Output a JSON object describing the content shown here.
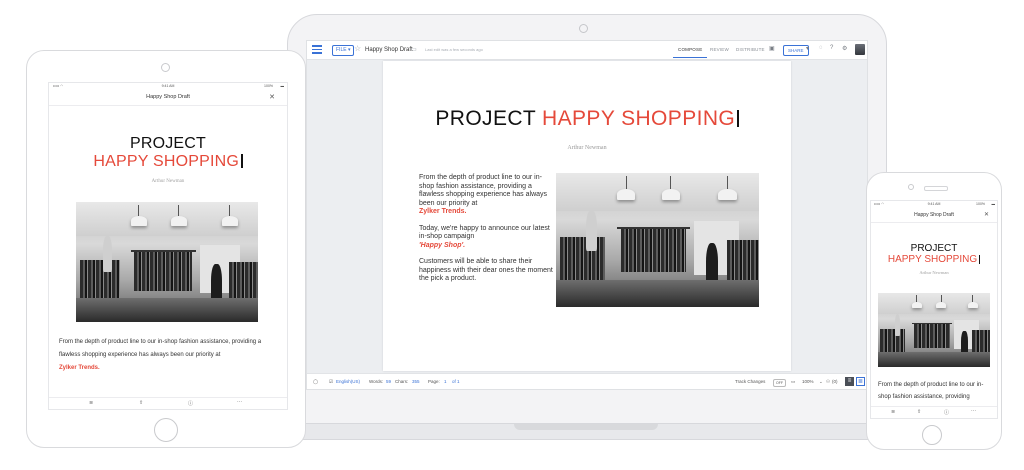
{
  "doc": {
    "title_plain": "PROJECT",
    "title_accent": "HAPPY SHOPPING",
    "author": "Arthur Newman",
    "brand_color": "#e5493a",
    "accent_color": "#3a72d6"
  },
  "laptop": {
    "file_button": "FILE ▾",
    "doc_name": "Happy Shop Draft",
    "last_edit": "Last edit was a few seconds ago",
    "tabs": [
      "COMPOSE",
      "REVIEW",
      "DISTRIBUTE"
    ],
    "share_label": "SHARE",
    "body": {
      "p1": "From the depth of product line to our in-shop fashion assistance, providing a flawless shopping experience has always been our priority at",
      "p1_brand": "Zylker Trends.",
      "p2": "Today, we're happy to announce our latest in-shop campaign",
      "p2_campaign": "'Happy Shop'.",
      "p3": "Customers will be able to share their happiness with their dear ones the moment the pick a product."
    },
    "status": {
      "language": "English(US)",
      "words_label": "Words:",
      "words": "59",
      "chars_label": "Chars:",
      "chars": "355",
      "page_label": "Page:",
      "page": "1",
      "of": "of 1",
      "track_changes": "Track Changes",
      "track_state": "OFF",
      "zoom": "100%",
      "collab": "(0)"
    }
  },
  "tablet": {
    "time": "9:41 AM",
    "battery": "100%",
    "nav_title": "Happy Shop Draft",
    "body": "From the depth of product line to our in-shop fashion assistance, providing a flawless shopping experience has always been our priority at",
    "brand": "Zylker Trends."
  },
  "phone": {
    "time": "9:41 AM",
    "battery": "100%",
    "nav_title": "Happy Shop Draft",
    "body": "From the depth of product line to our in-shop fashion assistance, providing"
  }
}
